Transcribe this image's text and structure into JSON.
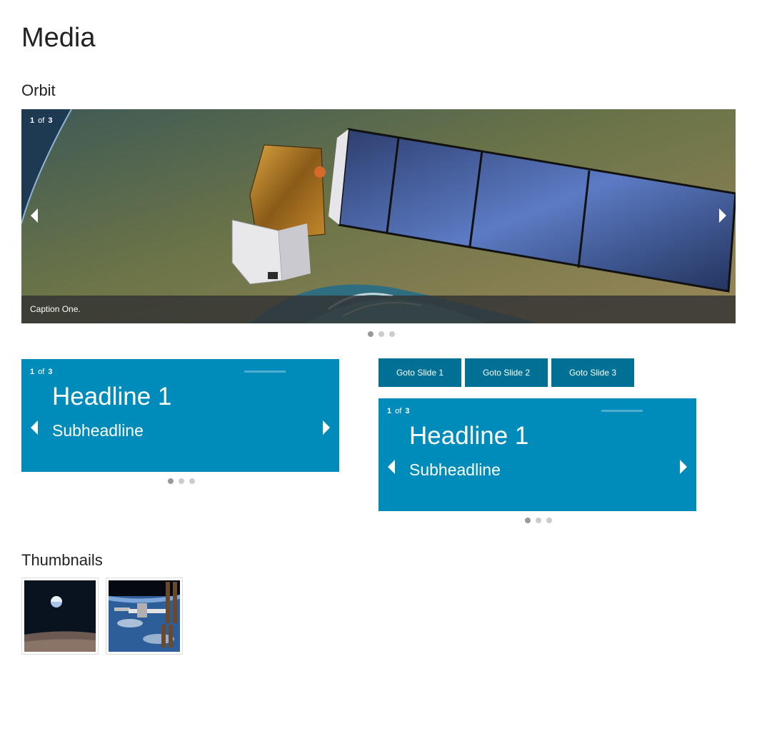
{
  "page": {
    "title": "Media"
  },
  "sections": {
    "orbit": "Orbit",
    "thumbnails": "Thumbnails"
  },
  "image_orbit": {
    "slide_current": "1",
    "slide_of": "of",
    "slide_total": "3",
    "caption": "Caption One.",
    "bullets": 3,
    "active_bullet": 0
  },
  "text_orbit_1": {
    "slide_current": "1",
    "slide_of": "of",
    "slide_total": "3",
    "headline": "Headline 1",
    "subheadline": "Subheadline",
    "bullets": 3,
    "active_bullet": 0
  },
  "text_orbit_2": {
    "slide_current": "1",
    "slide_of": "of",
    "slide_total": "3",
    "headline": "Headline 1",
    "subheadline": "Subheadline",
    "bullets": 3,
    "active_bullet": 0
  },
  "goto_buttons": [
    "Goto Slide 1",
    "Goto Slide 2",
    "Goto Slide 3"
  ],
  "thumbnails": [
    {
      "icon": "earthrise-thumbnail"
    },
    {
      "icon": "space-station-thumbnail"
    }
  ],
  "colors": {
    "accent": "#008cba",
    "button": "#007095",
    "caption_bg": "#323232",
    "bullet_active": "#999999",
    "bullet_inactive": "#cccccc"
  }
}
